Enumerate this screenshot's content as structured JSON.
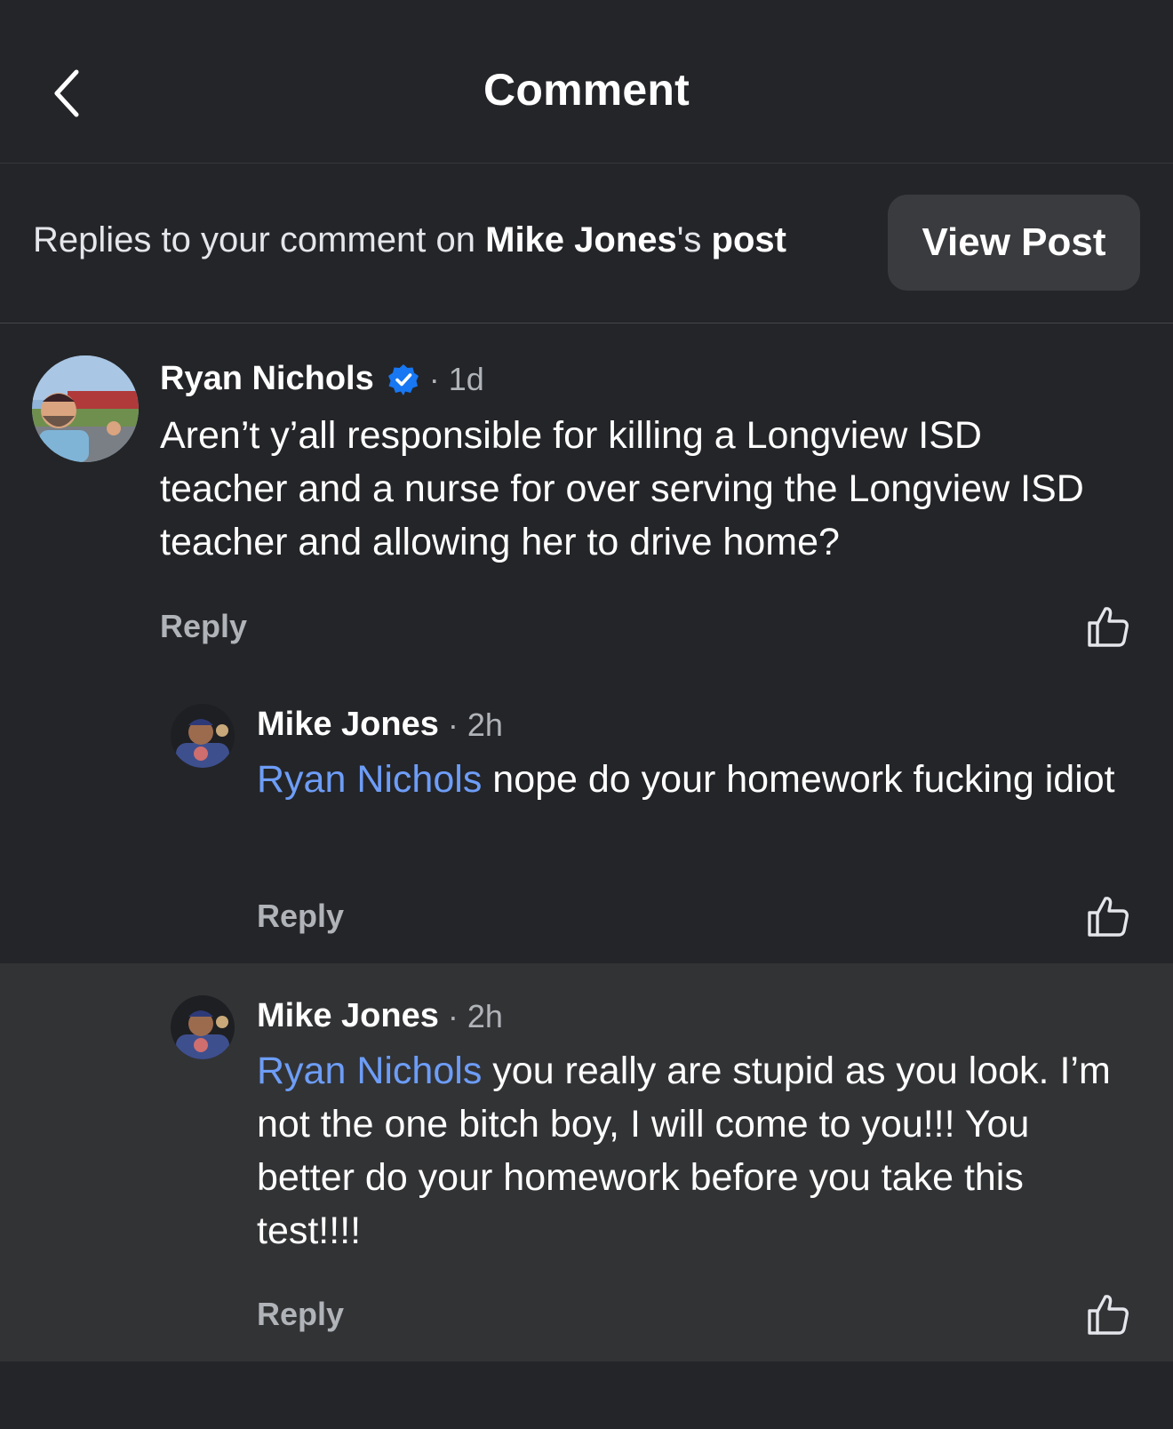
{
  "header": {
    "title": "Comment"
  },
  "context": {
    "prefix": "Replies to your comment on ",
    "author": "Mike Jones",
    "possessive": "'s ",
    "post_word": "post",
    "view_post_label": "View Post"
  },
  "comments": [
    {
      "name": "Ryan Nichols",
      "time": "· 1d",
      "verified": true,
      "text": "Aren’t y’all responsible for killing a Longview ISD teacher and a nurse for over serving the Longview ISD teacher and allowing her to drive home?",
      "reply_label": "Reply"
    },
    {
      "name": "Mike Jones",
      "time": "· 2h",
      "mention": "Ryan Nichols",
      "text": " nope do your homework fucking idiot",
      "reply_label": "Reply"
    },
    {
      "name": "Mike Jones",
      "time": "· 2h",
      "mention": "Ryan Nichols",
      "text": " you really are stupid as you look. I’m not the one bitch boy, I will come to you!!! You better do your homework before you take this test!!!!",
      "reply_label": "Reply"
    }
  ],
  "colors": {
    "background": "#242528",
    "highlight": "#323335",
    "mention": "#6d9df7",
    "verified": "#1877f2"
  },
  "icons": {
    "back": "chevron-left-icon",
    "verified": "verified-badge-icon",
    "like": "thumbs-up-icon"
  }
}
